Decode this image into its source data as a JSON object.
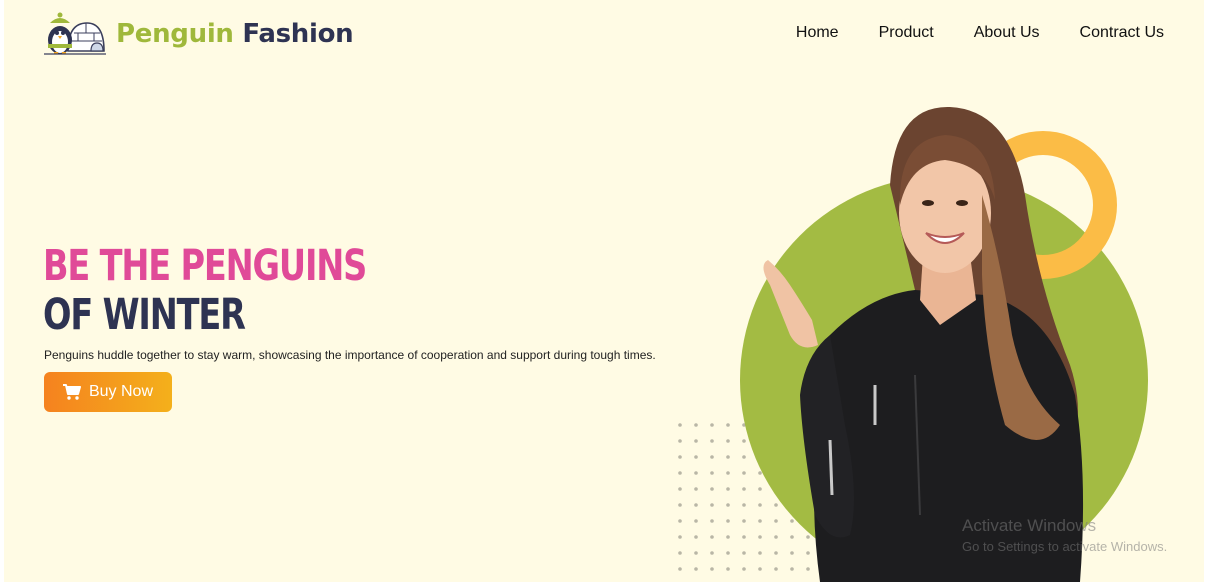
{
  "brand": {
    "name_part1": "Penguin",
    "name_part2": "Fashion",
    "logo_icon": "penguin-igloo-icon",
    "color_primary": "#9fb83b",
    "color_secondary": "#2e3352"
  },
  "nav": {
    "items": [
      {
        "label": "Home"
      },
      {
        "label": "Product"
      },
      {
        "label": "About Us"
      },
      {
        "label": "Contract Us"
      }
    ]
  },
  "hero": {
    "title_line1": "BE THE PENGUINS",
    "title_line2": "OF WINTER",
    "title_color1": "#e04a98",
    "title_color2": "#2e3352",
    "description": "Penguins huddle together to stay warm, showcasing the importance of cooperation and support during tough times.",
    "cta_label": "Buy Now",
    "cta_icon": "shopping-cart-icon",
    "cta_gradient": [
      "#f5821f",
      "#f4b01b"
    ]
  },
  "hero_art": {
    "description_icon": "model-in-leather-jacket-image",
    "circle_color": "#a3bb43",
    "ring_color": "#fbbc46"
  },
  "watermark": {
    "line1": "Activate Windows",
    "line2": "Go to Settings to activate Windows."
  }
}
